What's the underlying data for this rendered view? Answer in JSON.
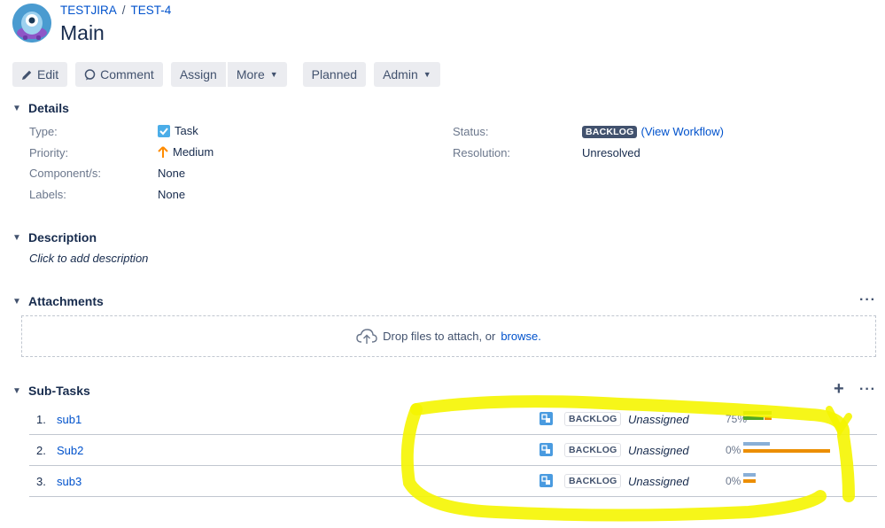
{
  "header": {
    "project": "TESTJIRA",
    "separator": "/",
    "issue_key": "TEST-4",
    "title": "Main"
  },
  "toolbar": {
    "edit": "Edit",
    "comment": "Comment",
    "assign": "Assign",
    "more": "More",
    "planned": "Planned",
    "admin": "Admin"
  },
  "details": {
    "heading": "Details",
    "type_label": "Type:",
    "type_value": "Task",
    "priority_label": "Priority:",
    "priority_value": "Medium",
    "components_label": "Component/s:",
    "components_value": "None",
    "labels_label": "Labels:",
    "labels_value": "None",
    "status_label": "Status:",
    "status_value": "BACKLOG",
    "view_workflow": "(View Workflow)",
    "resolution_label": "Resolution:",
    "resolution_value": "Unresolved"
  },
  "description": {
    "heading": "Description",
    "placeholder": "Click to add description"
  },
  "attachments": {
    "heading": "Attachments",
    "drop_text": "Drop files to attach, or",
    "browse": "browse."
  },
  "subtasks": {
    "heading": "Sub-Tasks",
    "items": [
      {
        "num": "1.",
        "name": "sub1",
        "status": "BACKLOG",
        "assignee": "Unassigned",
        "progress": "75%"
      },
      {
        "num": "2.",
        "name": "Sub2",
        "status": "BACKLOG",
        "assignee": "Unassigned",
        "progress": "0%"
      },
      {
        "num": "3.",
        "name": "sub3",
        "status": "BACKLOG",
        "assignee": "Unassigned",
        "progress": "0%"
      }
    ]
  },
  "colors": {
    "link": "#0052cc",
    "highlight": "#f5f500",
    "bar_green": "#51a825",
    "bar_orange": "#ec8e00",
    "bar_blue": "#89afd7"
  }
}
